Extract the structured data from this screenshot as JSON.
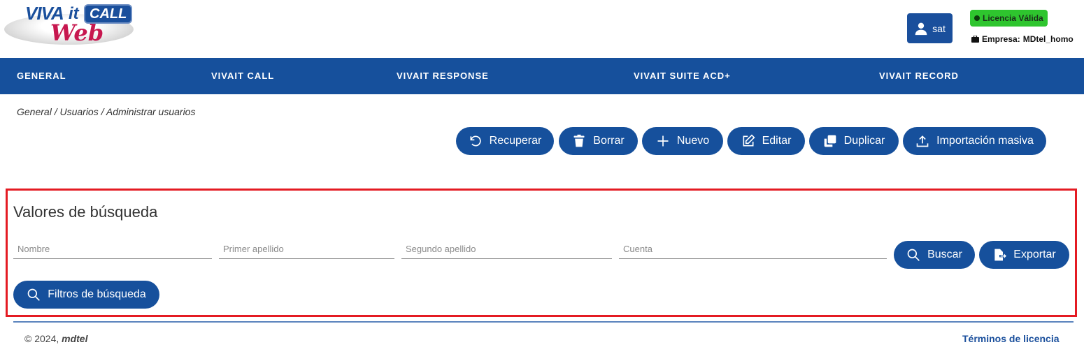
{
  "app": {
    "logo": {
      "viva": "VIVA",
      "it": "it",
      "call": "CALL",
      "web": "Web"
    }
  },
  "header": {
    "user_label": "sat",
    "license_label": "Licencia Válida",
    "company_prefix": "Empresa:",
    "company_value": "MDtel_homo"
  },
  "nav": {
    "items": [
      {
        "label": "GENERAL"
      },
      {
        "label": "VIVAIT CALL"
      },
      {
        "label": "VIVAIT RESPONSE"
      },
      {
        "label": "VIVAIT SUITE ACD+"
      },
      {
        "label": "VIVAIT RECORD"
      }
    ]
  },
  "breadcrumb": "General / Usuarios / Administrar usuarios",
  "toolbar": {
    "recover": "Recuperar",
    "delete": "Borrar",
    "new": "Nuevo",
    "edit": "Editar",
    "duplicate": "Duplicar",
    "bulk_import": "Importación masiva"
  },
  "search": {
    "title": "Valores de búsqueda",
    "fields": {
      "name_placeholder": "Nombre",
      "surname1_placeholder": "Primer apellido",
      "surname2_placeholder": "Segundo apellido",
      "account_placeholder": "Cuenta"
    },
    "search_button": "Buscar",
    "export_button": "Exportar",
    "filters_button": "Filtros de búsqueda"
  },
  "footer": {
    "copyright_prefix": "© 2024, ",
    "brand": "mdtel",
    "terms": "Términos de licencia"
  },
  "colors": {
    "primary": "#16509c",
    "license_green": "#2ec52e",
    "highlight_red": "#e41b23"
  }
}
